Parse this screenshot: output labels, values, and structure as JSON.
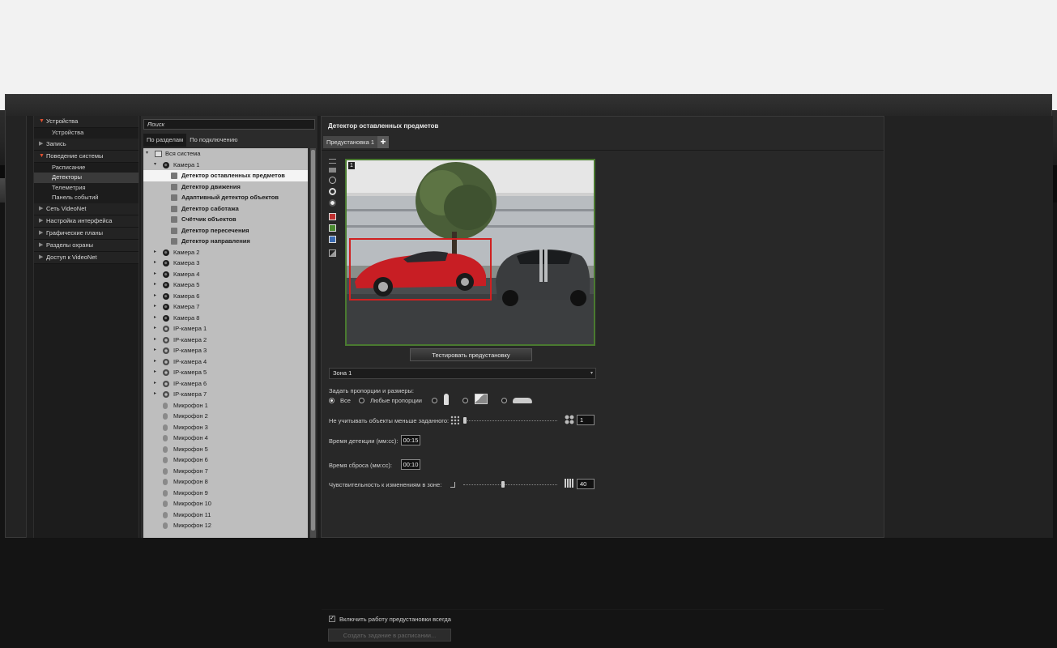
{
  "nav": {
    "sections": [
      {
        "label": "Устройства",
        "open": true,
        "items": [
          {
            "label": "Устройства",
            "selected": false
          }
        ]
      },
      {
        "label": "Запись",
        "open": false,
        "items": []
      },
      {
        "label": "Поведение системы",
        "open": true,
        "items": [
          {
            "label": "Расписание",
            "selected": false
          },
          {
            "label": "Детекторы",
            "selected": true
          },
          {
            "label": "Телеметрия",
            "selected": false
          },
          {
            "label": "Панель событий",
            "selected": false
          }
        ]
      },
      {
        "label": "Сеть VideoNet",
        "open": false,
        "items": []
      },
      {
        "label": "Настройка интерфейса",
        "open": false,
        "items": []
      },
      {
        "label": "Графические планы",
        "open": false,
        "items": []
      },
      {
        "label": "Разделы охраны",
        "open": false,
        "items": []
      },
      {
        "label": "Доступ к VideoNet",
        "open": false,
        "items": []
      }
    ]
  },
  "search": {
    "placeholder": "Поиск"
  },
  "tabs": [
    "По разделам",
    "По подключению"
  ],
  "tree": [
    {
      "label": "Вся система",
      "level": 0,
      "arrow": "▾",
      "icon": "sys"
    },
    {
      "label": "Камера 1",
      "level": 1,
      "arrow": "▾",
      "icon": "cam"
    },
    {
      "label": "Детектор оставленных предметов",
      "level": 2,
      "icon": "det",
      "bold": true,
      "selected": true
    },
    {
      "label": "Детектор движения",
      "level": 2,
      "icon": "det",
      "bold": true
    },
    {
      "label": "Адаптивный детектор объектов",
      "level": 2,
      "icon": "det",
      "bold": true
    },
    {
      "label": "Детектор саботажа",
      "level": 2,
      "icon": "det",
      "bold": true
    },
    {
      "label": "Счётчик объектов",
      "level": 2,
      "icon": "det",
      "bold": true
    },
    {
      "label": "Детектор пересечения",
      "level": 2,
      "icon": "det",
      "bold": true
    },
    {
      "label": "Детектор направления",
      "level": 2,
      "icon": "det",
      "bold": true
    },
    {
      "label": "Камера 2",
      "level": 1,
      "arrow": "▸",
      "icon": "cam"
    },
    {
      "label": "Камера 3",
      "level": 1,
      "arrow": "▸",
      "icon": "cam"
    },
    {
      "label": "Камера 4",
      "level": 1,
      "arrow": "▸",
      "icon": "cam"
    },
    {
      "label": "Камера 5",
      "level": 1,
      "arrow": "▸",
      "icon": "cam"
    },
    {
      "label": "Камера 6",
      "level": 1,
      "arrow": "▸",
      "icon": "cam"
    },
    {
      "label": "Камера 7",
      "level": 1,
      "arrow": "▸",
      "icon": "cam"
    },
    {
      "label": "Камера 8",
      "level": 1,
      "arrow": "▸",
      "icon": "cam"
    },
    {
      "label": "IP-камера 1",
      "level": 1,
      "arrow": "▸",
      "icon": "ip"
    },
    {
      "label": "IP-камера 2",
      "level": 1,
      "arrow": "▸",
      "icon": "ip"
    },
    {
      "label": "IP-камера 3",
      "level": 1,
      "arrow": "▸",
      "icon": "ip"
    },
    {
      "label": "IP-камера 4",
      "level": 1,
      "arrow": "▸",
      "icon": "ip"
    },
    {
      "label": "IP-камера 5",
      "level": 1,
      "arrow": "▸",
      "icon": "ip"
    },
    {
      "label": "IP-камера 6",
      "level": 1,
      "arrow": "▸",
      "icon": "ip"
    },
    {
      "label": "IP-камера 7",
      "level": 1,
      "arrow": "▸",
      "icon": "ip"
    },
    {
      "label": "Микрофон 1",
      "level": 1,
      "icon": "mic"
    },
    {
      "label": "Микрофон 2",
      "level": 1,
      "icon": "mic"
    },
    {
      "label": "Микрофон 3",
      "level": 1,
      "icon": "mic"
    },
    {
      "label": "Микрофон 4",
      "level": 1,
      "icon": "mic"
    },
    {
      "label": "Микрофон 5",
      "level": 1,
      "icon": "mic"
    },
    {
      "label": "Микрофон 6",
      "level": 1,
      "icon": "mic"
    },
    {
      "label": "Микрофон 7",
      "level": 1,
      "icon": "mic"
    },
    {
      "label": "Микрофон 8",
      "level": 1,
      "icon": "mic"
    },
    {
      "label": "Микрофон 9",
      "level": 1,
      "icon": "mic"
    },
    {
      "label": "Микрофон 10",
      "level": 1,
      "icon": "mic"
    },
    {
      "label": "Микрофон 11",
      "level": 1,
      "icon": "mic"
    },
    {
      "label": "Микрофон 12",
      "level": 1,
      "icon": "mic"
    }
  ],
  "detail": {
    "title": "Детектор оставленных предметов",
    "preset_tab": "Предустановка 1",
    "preset_add": "+",
    "video_number": "1",
    "test_button": "Тестировать предустановку",
    "zone_select": "Зона 1",
    "proportions_label": "Задать пропорции и размеры:",
    "radio_all": "Все",
    "radio_any": "Любые пропорции",
    "ignore_label": "Не учитывать объекты меньше заданного:",
    "ignore_value": "1",
    "detect_time_label": "Время детекции (мм:сс):",
    "detect_time_value": "00:15",
    "reset_time_label": "Время сброса (мм:сс):",
    "reset_time_value": "00:10",
    "sensitivity_label": "Чувствительность к изменениям в зоне:",
    "sensitivity_value": "40",
    "enable_always_label": "Включить работу предустановки всегда",
    "enable_always_checked": true,
    "schedule_button": "Создать задание в расписании..."
  },
  "colors": {
    "zone_red": "#d02020",
    "video_border": "#4a7a30",
    "nav_open_arrow": "#e05030"
  }
}
